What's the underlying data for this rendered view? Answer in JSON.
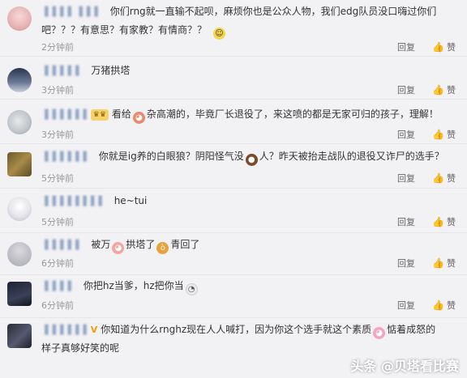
{
  "comments": [
    {
      "username": "▐▐▐▐ ▐▐▐",
      "lines": [
        "你们rng就一直输不起呗，麻烦你也是公众人物，我们edg队员没口嗨过你们",
        "吧？？？有意思？有家教？有情商？？"
      ],
      "time": "2分钟前",
      "reply": "回复",
      "likes": "赞"
    },
    {
      "username": "▐▐▐▐▐",
      "lines": [
        "万猪拱塔"
      ],
      "time": "3分钟前",
      "reply": "回复",
      "likes": "赞"
    },
    {
      "username": "▐▐▐▐▐▐",
      "lines": [
        "看给",
        "杂高潮的，毕竟厂长退役了，来这喷的都是无家可归的孩子，理解！"
      ],
      "time": "3分钟前",
      "reply": "回复",
      "likes": "赞"
    },
    {
      "username": "▐▐▐▐▐▐",
      "lines": [
        "你就是ig养的白眼狼？阴阳怪气没",
        "人？昨天被抬走战队的退役又诈尸的选手？"
      ],
      "time": "5分钟前",
      "reply": "回复",
      "likes": "赞"
    },
    {
      "username": "▐▐▐▐▐▐▐▐",
      "lines": [
        "he~tui"
      ],
      "time": "5分钟前",
      "reply": "回复",
      "likes": "赞"
    },
    {
      "username": "▐▐▐▐▐",
      "lines": [
        "被万",
        "拱塔了",
        "青回了"
      ],
      "time": "6分钟前",
      "reply": "回复",
      "likes": "赞"
    },
    {
      "username": "▐▐▐▐",
      "lines": [
        "你把hz当爹，hz把你当"
      ],
      "time": "6分钟前",
      "reply": "回复",
      "likes": "赞"
    },
    {
      "username": "▐▐▐▐▐▐",
      "lines": [
        "你知道为什么rnghz现在人人喊打，因为你这个选手就这个素质",
        "惦着成怒的",
        "样子真够好笑的呢"
      ],
      "time": "",
      "reply": "",
      "likes": ""
    }
  ],
  "watermark": "头条 @贝塔看比赛",
  "colors": {
    "background": "#f2f2f5",
    "meta": "#999999",
    "username": "#8fa3c2",
    "badge": "#f7d26a"
  },
  "icons": [
    "smile-emoji-icon",
    "pig-emoji-icon",
    "thumb-up-icon"
  ]
}
